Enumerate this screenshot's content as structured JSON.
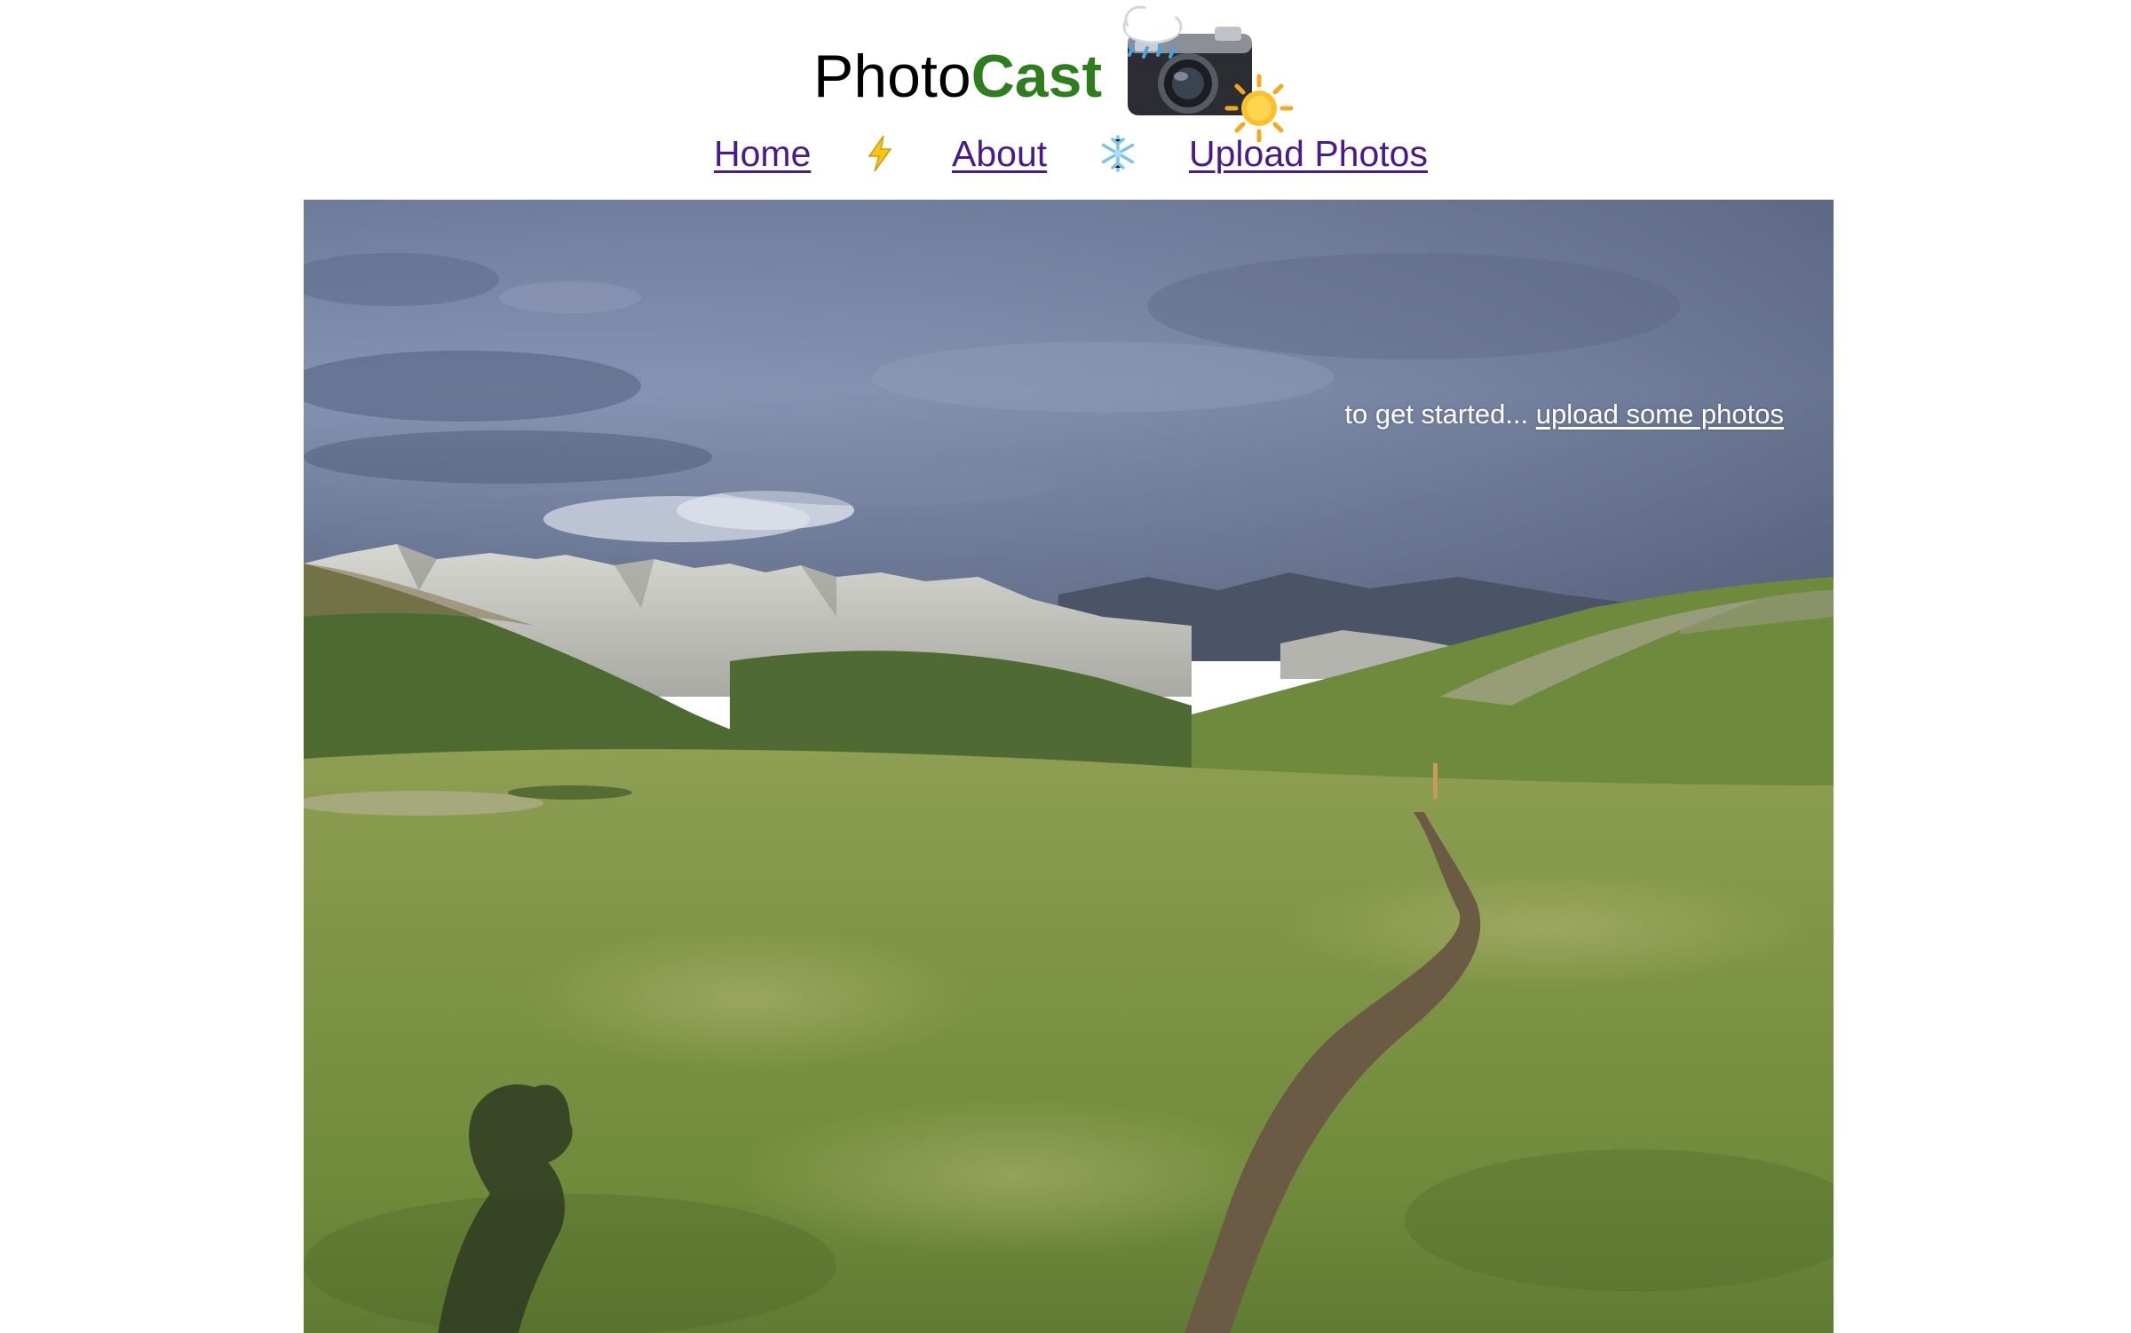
{
  "brand": {
    "name_part1": "Photo",
    "name_part2": "Cast",
    "logo_icon": "camera-with-weather-icon",
    "accent_color": "#2f7d1e"
  },
  "nav": {
    "items": [
      {
        "label": "Home"
      },
      {
        "label": "About"
      },
      {
        "label": "Upload Photos"
      }
    ],
    "separators": [
      "lightning-icon",
      "snowflake-icon"
    ],
    "link_color": "#4b1a8a"
  },
  "hero": {
    "image": "mountain-meadow-photo",
    "cta_prefix": "to get started...",
    "cta_link": "upload some photos"
  }
}
